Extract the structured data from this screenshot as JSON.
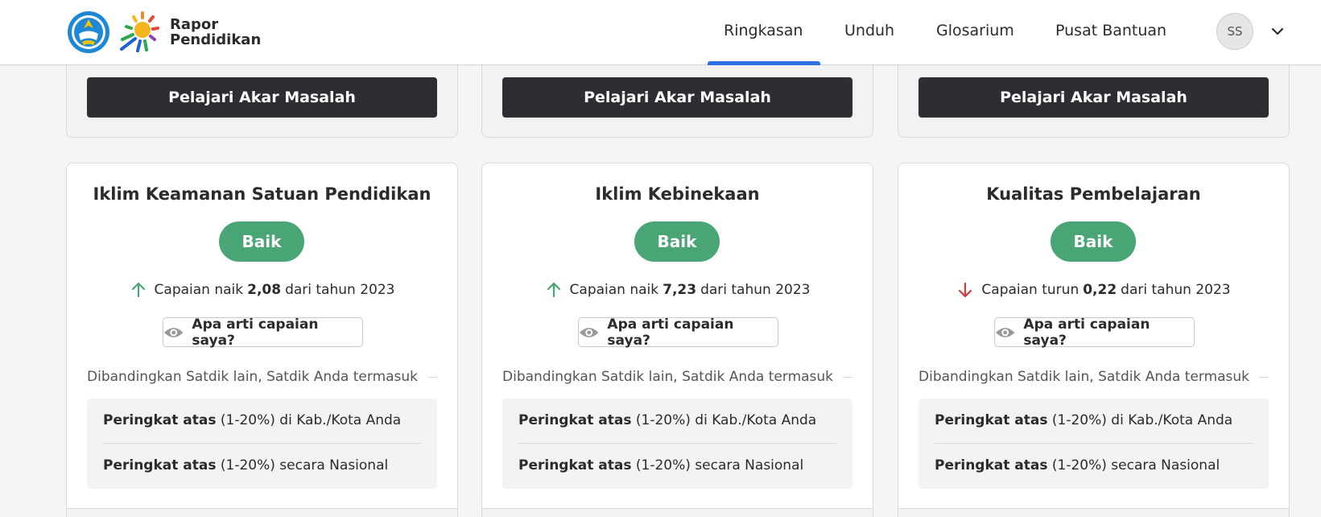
{
  "header": {
    "brand_line1": "Rapor",
    "brand_line2": "Pendidikan",
    "nav": [
      {
        "label": "Ringkasan",
        "active": true
      },
      {
        "label": "Unduh",
        "active": false
      },
      {
        "label": "Glosarium",
        "active": false
      },
      {
        "label": "Pusat Bantuan",
        "active": false
      }
    ],
    "avatar_initials": "SS"
  },
  "top_cards": [
    {
      "button_label": "Pelajari Akar Masalah"
    },
    {
      "button_label": "Pelajari Akar Masalah"
    },
    {
      "button_label": "Pelajari Akar Masalah"
    }
  ],
  "cards": [
    {
      "title": "Iklim Keamanan Satuan Pendidikan",
      "status": "Baik",
      "trend_direction": "up",
      "trend_prefix": "Capaian naik",
      "trend_value": "2,08",
      "trend_suffix": "dari tahun 2023",
      "help_label": "Apa arti capaian saya?",
      "compare_label": "Dibandingkan Satdik lain, Satdik Anda termasuk",
      "rank_regional_bold": "Peringkat atas",
      "rank_regional_rest": "(1-20%) di Kab./Kota Anda",
      "rank_national_bold": "Peringkat atas",
      "rank_national_rest": "(1-20%) secara Nasional"
    },
    {
      "title": "Iklim Kebinekaan",
      "status": "Baik",
      "trend_direction": "up",
      "trend_prefix": "Capaian naik",
      "trend_value": "7,23",
      "trend_suffix": "dari tahun 2023",
      "help_label": "Apa arti capaian saya?",
      "compare_label": "Dibandingkan Satdik lain, Satdik Anda termasuk",
      "rank_regional_bold": "Peringkat atas",
      "rank_regional_rest": "(1-20%) di Kab./Kota Anda",
      "rank_national_bold": "Peringkat atas",
      "rank_national_rest": "(1-20%) secara Nasional"
    },
    {
      "title": "Kualitas Pembelajaran",
      "status": "Baik",
      "trend_direction": "down",
      "trend_prefix": "Capaian turun",
      "trend_value": "0,22",
      "trend_suffix": "dari tahun 2023",
      "help_label": "Apa arti capaian saya?",
      "compare_label": "Dibandingkan Satdik lain, Satdik Anda termasuk",
      "rank_regional_bold": "Peringkat atas",
      "rank_regional_rest": "(1-20%) di Kab./Kota Anda",
      "rank_national_bold": "Peringkat atas",
      "rank_national_rest": "(1-20%) secara Nasional"
    }
  ],
  "colors": {
    "status_good": "#4aa574",
    "trend_up": "#4aa574",
    "trend_down": "#d9363e",
    "nav_active": "#2f6fe4",
    "button_dark": "#2d2e31"
  },
  "icons": {
    "help": "eye-icon",
    "trend_up": "arrow-up-icon",
    "trend_down": "arrow-down-icon",
    "menu": "chevron-down-icon"
  }
}
